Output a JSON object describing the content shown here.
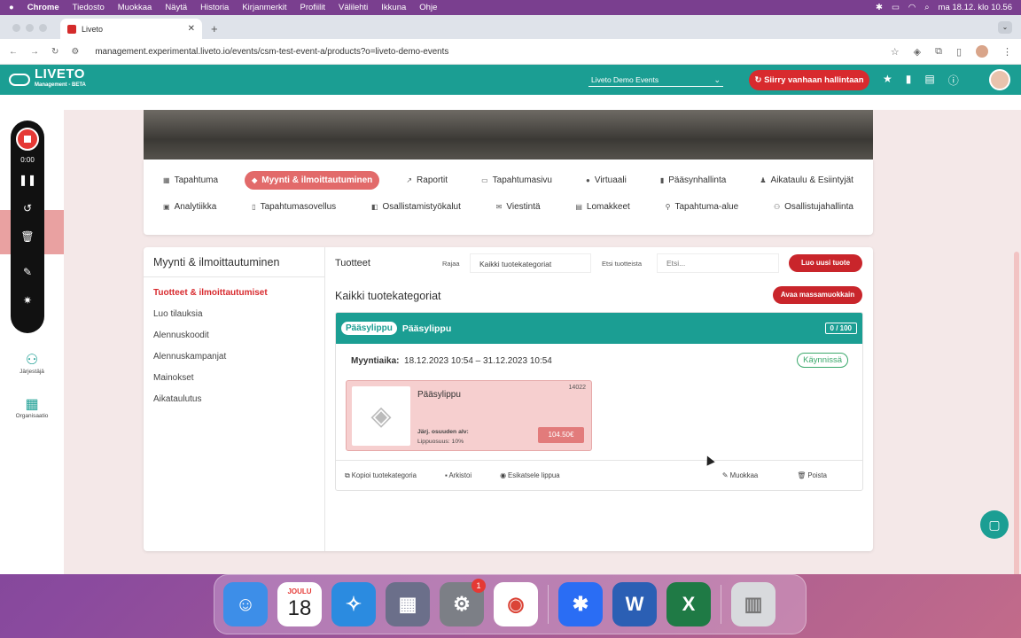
{
  "menubar": {
    "apple": "",
    "app": "Chrome",
    "items": [
      "Tiedosto",
      "Muokkaa",
      "Näytä",
      "Historia",
      "Kirjanmerkit",
      "Profiilit",
      "Välilehti",
      "Ikkuna",
      "Ohje"
    ],
    "clock": "ma 18.12. klo 10.56"
  },
  "browser": {
    "tab_title": "Liveto",
    "url": "management.experimental.liveto.io/events/csm-test-event-a/products?o=liveto-demo-events"
  },
  "header": {
    "logo": "LIVETO",
    "logo_sub": "Management - BETA",
    "event_select": "Liveto Demo Events",
    "old_button": "Siirry vanhaan hallintaan"
  },
  "recorder": {
    "time": "0:00"
  },
  "sidebar": {
    "items": [
      {
        "label": "Järjestäjä",
        "icon": "people-icon"
      },
      {
        "label": "Organisaatio",
        "icon": "building-icon"
      }
    ]
  },
  "nav": {
    "row1": [
      "Tapahtuma",
      "Myynti & ilmoittautuminen",
      "Raportit",
      "Tapahtumasivu",
      "Virtuaali",
      "Pääsynhallinta",
      "Aikataulu & Esiintyjät"
    ],
    "row2": [
      "Analytiikka",
      "Tapahtumasovellus",
      "Osallistamistyökalut",
      "Viestintä",
      "Lomakkeet",
      "Tapahtuma-alue",
      "Osallistujahallinta"
    ]
  },
  "sales": {
    "title": "Myynti & ilmoittautuminen",
    "menu": [
      "Tuotteet & ilmoittautumiset",
      "Luo tilauksia",
      "Alennuskoodit",
      "Alennuskampanjat",
      "Mainokset",
      "Aikataulutus"
    ],
    "products_label": "Tuotteet",
    "filter_label": "Rajaa",
    "filter_value": "Kaikki tuotekategoriat",
    "search_label": "Etsi tuotteista",
    "search_placeholder": "Etsi...",
    "new_product": "Luo uusi tuote",
    "category_heading": "Kaikki tuotekategoriat",
    "mass_edit": "Avaa massamuokkain"
  },
  "category": {
    "pill": "Pääsylippu",
    "name": "Pääsylippu",
    "count": "0 / 100",
    "sale_label": "Myyntiaika:",
    "sale_period": "18.12.2023 10:54 – 31.12.2023 10:54",
    "status": "Käynnissä",
    "actions": {
      "copy": "Kopioi tuotekategoria",
      "archive": "Arkistoi",
      "preview": "Esikatsele lippua",
      "edit": "Muokkaa",
      "delete": "Poista"
    }
  },
  "product": {
    "name": "Pääsylippu",
    "id": "14022",
    "vat_label": "Järj. osuuden alv:",
    "vat_detail": "Lippuosuus: 10%",
    "price": "104.50€"
  },
  "dock": {
    "calendar_month": "JOULU",
    "calendar_day": "18",
    "settings_badge": "1"
  },
  "colors": {
    "teal": "#1b9e93",
    "red": "#d82a2e",
    "active_tab": "#e26a6a"
  }
}
